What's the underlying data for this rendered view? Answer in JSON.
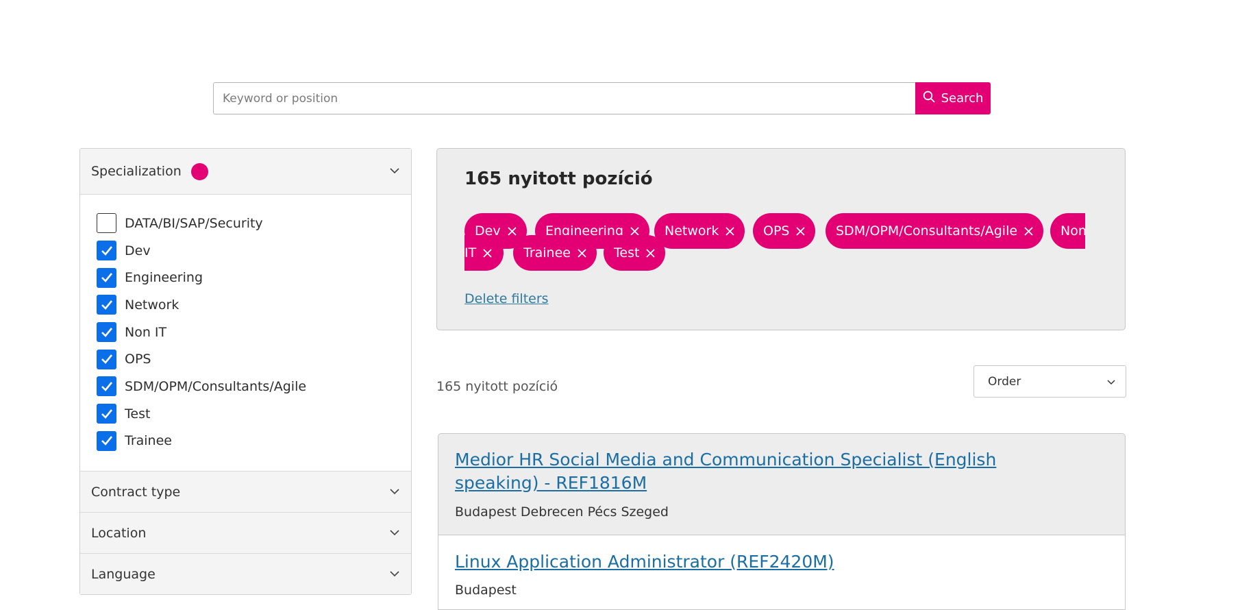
{
  "search": {
    "placeholder": "Keyword or position",
    "button_label": "Search"
  },
  "sidebar": {
    "specialization": {
      "label": "Specialization",
      "options": [
        {
          "label": "DATA/BI/SAP/Security",
          "checked": false
        },
        {
          "label": "Dev",
          "checked": true
        },
        {
          "label": "Engineering",
          "checked": true
        },
        {
          "label": "Network",
          "checked": true
        },
        {
          "label": "Non IT",
          "checked": true
        },
        {
          "label": "OPS",
          "checked": true
        },
        {
          "label": "SDM/OPM/Consultants/Agile",
          "checked": true
        },
        {
          "label": "Test",
          "checked": true
        },
        {
          "label": "Trainee",
          "checked": true
        }
      ]
    },
    "contract_type": "Contract type",
    "location": "Location",
    "language": "Language"
  },
  "filters": {
    "count_label": "165 nyitott pozíció",
    "chips": [
      "Dev",
      "Engineering",
      "Network",
      "OPS",
      "SDM/OPM/Consultants/Agile",
      "Non",
      "IT",
      "Trainee",
      "Test"
    ],
    "delete_label": "Delete filters"
  },
  "results": {
    "count_label": "165 nyitott pozíció",
    "order_label": "Order",
    "jobs": [
      {
        "title": "Medior HR Social Media and Communication Specialist (English speaking) - REF1816M",
        "location": "Budapest Debrecen Pécs Szeged"
      },
      {
        "title": "Linux Application Administrator (REF2420M)",
        "location": "Budapest"
      }
    ]
  },
  "colors": {
    "accent": "#e20074",
    "checkbox": "#0a6fe8",
    "link": "#1b6ea3"
  }
}
